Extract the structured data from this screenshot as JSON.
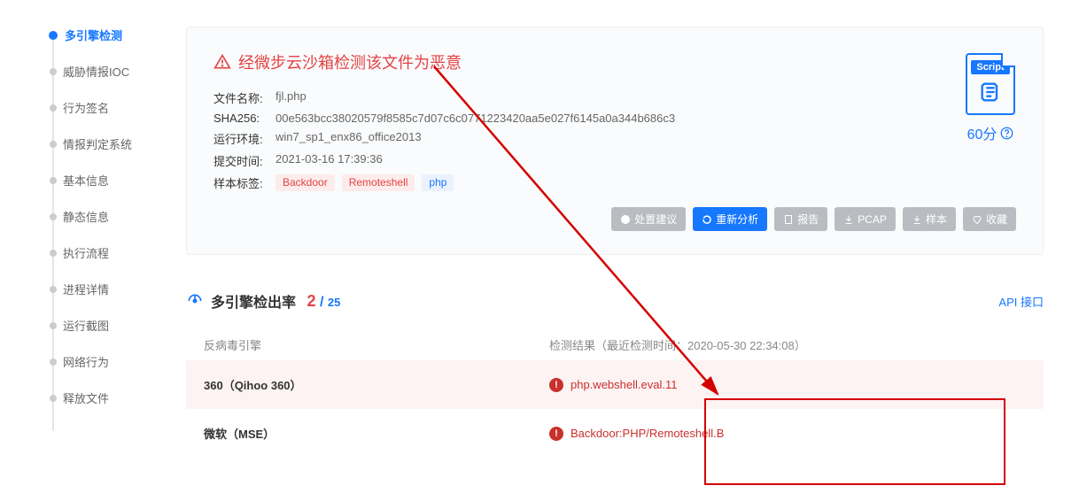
{
  "sidebar": {
    "items": [
      {
        "label": "多引擎检测",
        "active": true
      },
      {
        "label": "威胁情报IOC"
      },
      {
        "label": "行为签名"
      },
      {
        "label": "情报判定系统"
      },
      {
        "label": "基本信息"
      },
      {
        "label": "静态信息"
      },
      {
        "label": "执行流程"
      },
      {
        "label": "进程详情"
      },
      {
        "label": "运行截图"
      },
      {
        "label": "网络行为"
      },
      {
        "label": "释放文件"
      }
    ]
  },
  "alert": {
    "title": "经微步云沙箱检测该文件为恶意"
  },
  "meta": {
    "filename_label": "文件名称:",
    "filename": "fjl.php",
    "sha256_label": "SHA256:",
    "sha256": "00e563bcc38020579f8585c7d07c6c0771223420aa5e027f6145a0a344b686c3",
    "env_label": "运行环境:",
    "env": "win7_sp1_enx86_office2013",
    "submitted_label": "提交时间:",
    "submitted": "2021-03-16 17:39:36",
    "tags_label": "样本标签:",
    "tags": [
      {
        "text": "Backdoor",
        "cls": "tag-red"
      },
      {
        "text": "Remoteshell",
        "cls": "tag-red"
      },
      {
        "text": "php",
        "cls": "tag-blue"
      }
    ]
  },
  "score": {
    "icon_label": "Script",
    "value": "60分"
  },
  "buttons": {
    "suggest": "处置建议",
    "reanalyze": "重新分析",
    "report": "报告",
    "pcap": "PCAP",
    "sample": "样本",
    "favorite": "收藏"
  },
  "section": {
    "title": "多引擎检出率",
    "num": "2",
    "slash": "/",
    "den": "25",
    "api_link": "API 接口"
  },
  "table": {
    "col_engine": "反病毒引擎",
    "col_result_prefix": "检测结果（最近检测时间：",
    "last_time": "2020-05-30 22:34:08",
    "col_result_suffix": "）",
    "rows": [
      {
        "engine": "360（Qihoo 360）",
        "result": "php.webshell.eval.11",
        "threat": true
      },
      {
        "engine": "微软（MSE）",
        "result": "Backdoor:PHP/Remoteshell.B",
        "threat": true
      }
    ]
  }
}
